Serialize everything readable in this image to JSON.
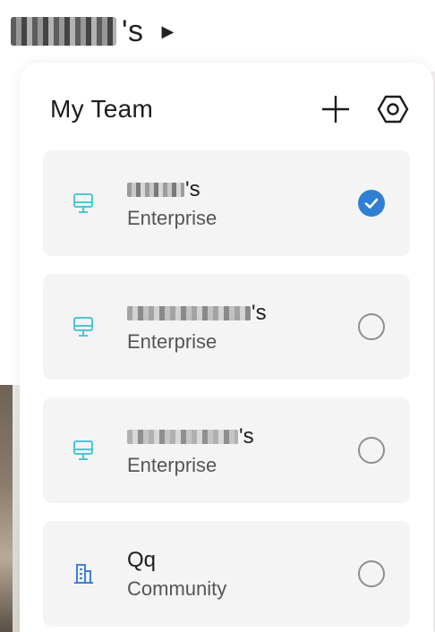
{
  "header": {
    "owner_suffix": "'s",
    "caret": "▶"
  },
  "panel": {
    "title": "My Team",
    "add_icon": "plus-icon",
    "settings_icon": "hexagon-settings-icon"
  },
  "teams": [
    {
      "name_suffix": "'s",
      "type": "Enterprise",
      "icon": "monitor-icon",
      "selected": true
    },
    {
      "name_suffix": "'s",
      "type": "Enterprise",
      "icon": "monitor-icon",
      "selected": false
    },
    {
      "name_suffix": "'s",
      "type": "Enterprise",
      "icon": "monitor-icon",
      "selected": false
    },
    {
      "name": "Qq",
      "type": "Community",
      "icon": "building-icon",
      "selected": false
    }
  ],
  "colors": {
    "accent": "#2f7fd3",
    "monitor_icon": "#4ec5d8",
    "building_icon": "#3f7fd6"
  }
}
